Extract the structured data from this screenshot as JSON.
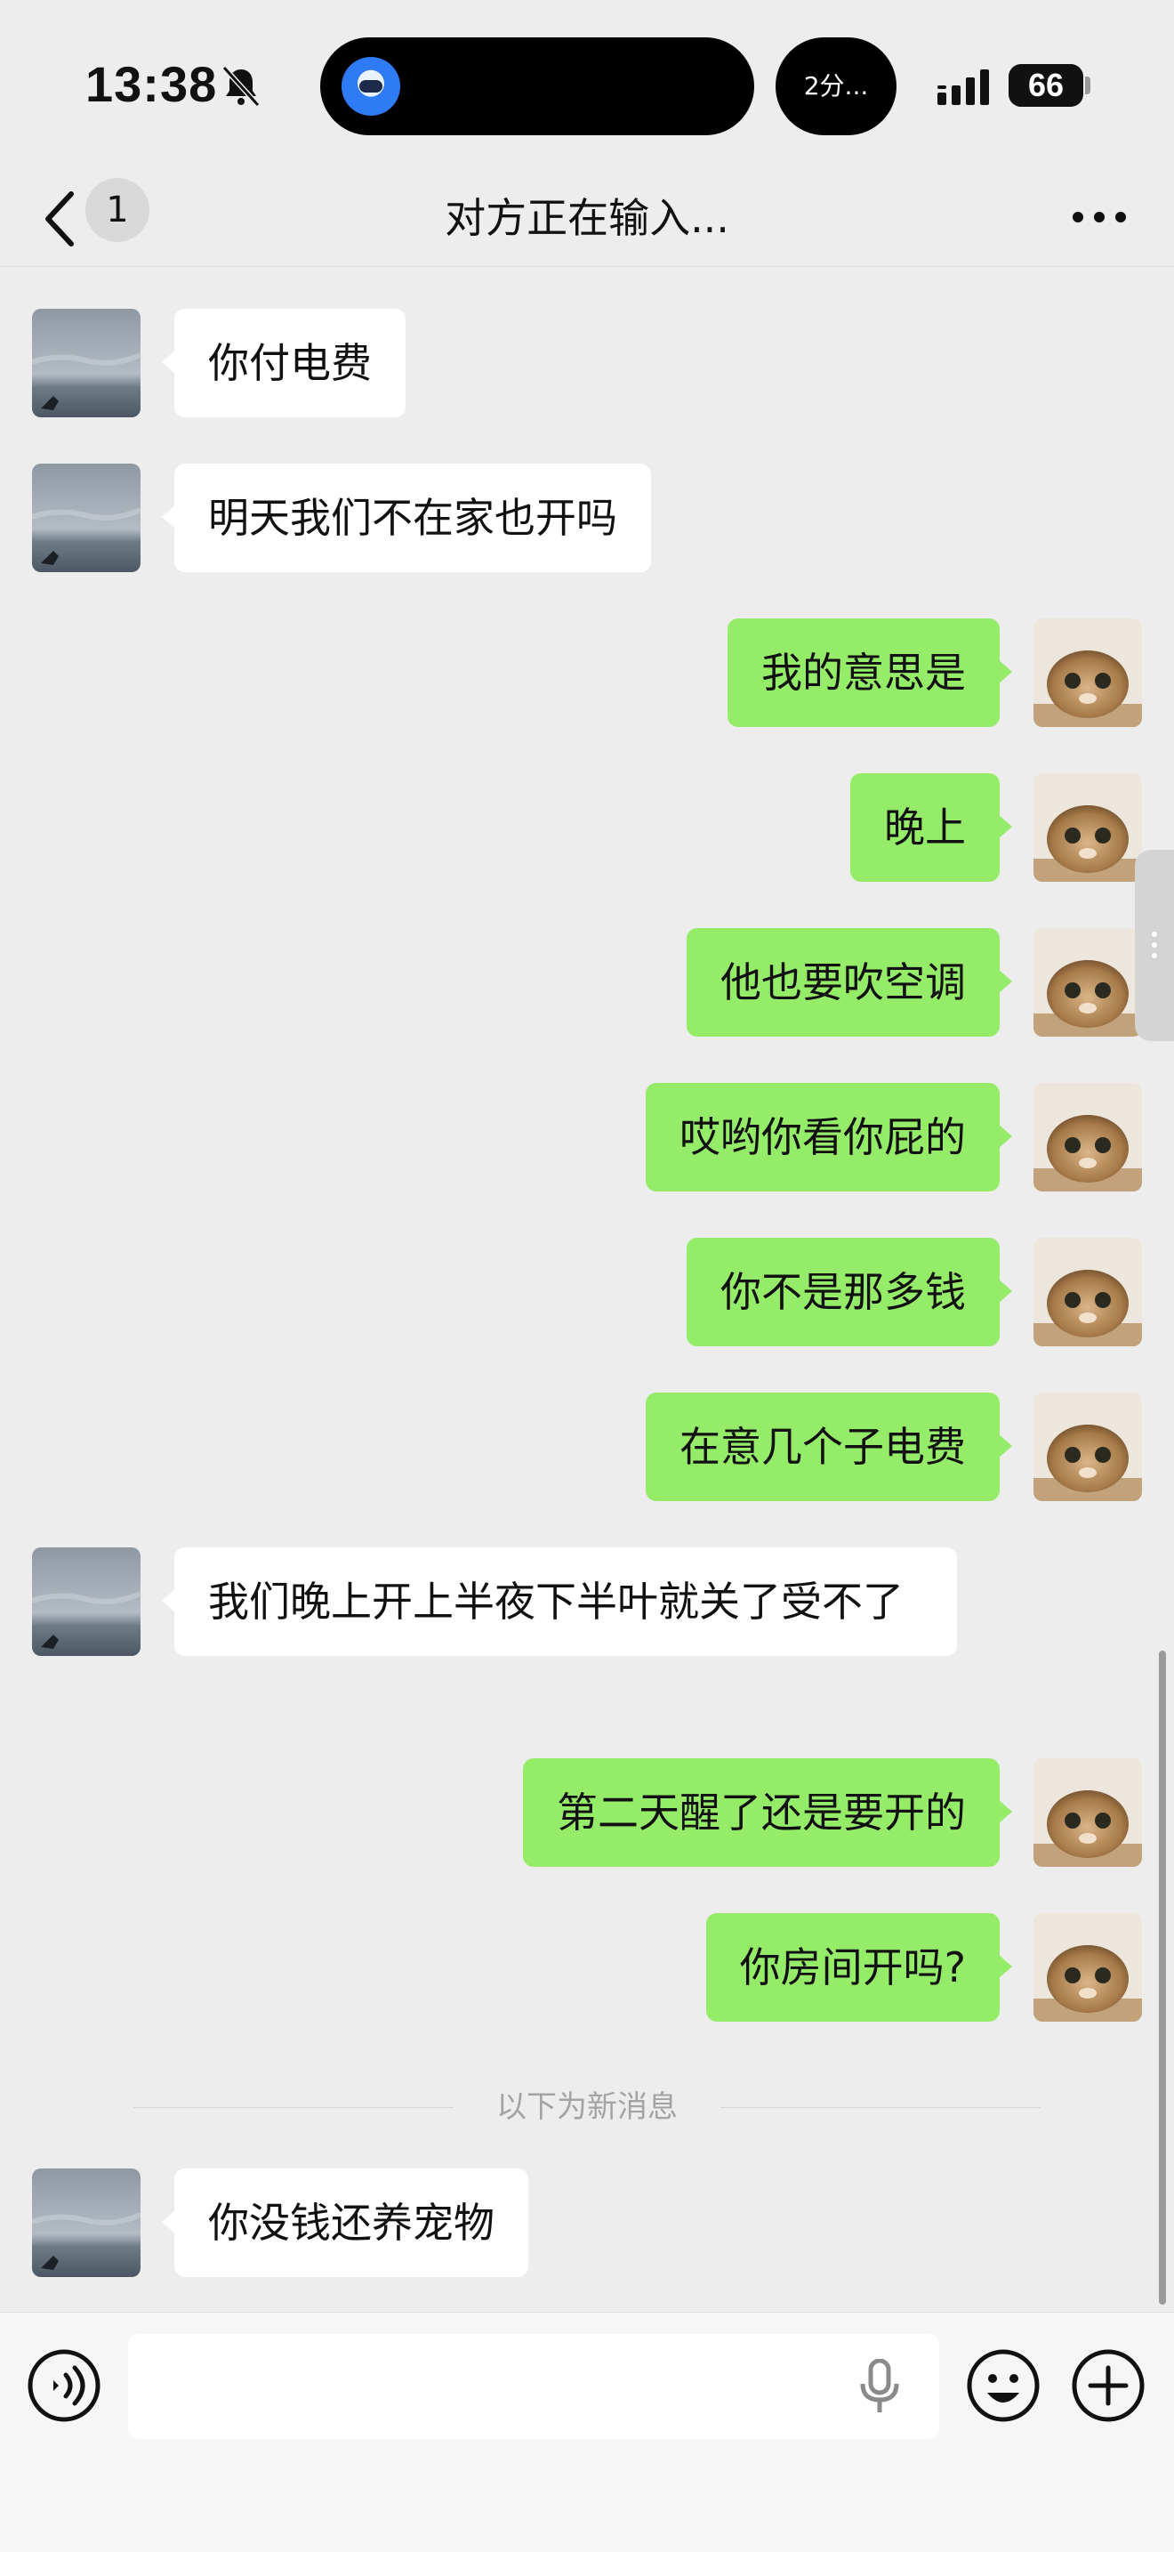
{
  "status_bar": {
    "time": "13:38",
    "timer_label": "2分...",
    "battery": "66",
    "icons": [
      "bell-off-icon",
      "signal-icon",
      "battery-icon"
    ]
  },
  "nav": {
    "back_icon": "chevron-left-icon",
    "unread_count": "1",
    "title": "对方正在输入...",
    "more_icon": "ellipsis-icon"
  },
  "colors": {
    "background": "#ededed",
    "incoming_bubble": "#ffffff",
    "outgoing_bubble": "#95ec69"
  },
  "messages": [
    {
      "from": "contact",
      "text": "你付电费"
    },
    {
      "from": "me",
      "text": "明天我们不在家也开吗"
    },
    {
      "from": "me",
      "text": "我的意思是"
    },
    {
      "from": "me",
      "text": "晚上"
    },
    {
      "from": "me",
      "text": "他也要吹空调"
    },
    {
      "from": "me",
      "text": "哎哟你看你屁的"
    },
    {
      "from": "me",
      "text": "你不是那多钱"
    },
    {
      "from": "me",
      "text": "在意几个子电费"
    },
    {
      "from": "contact",
      "text": "我们晚上开上半夜下半叶就关了受不了"
    },
    {
      "from": "me",
      "text": "第二天醒了还是要开的"
    },
    {
      "from": "me",
      "text": "你房间开吗?"
    },
    {
      "from": "contact",
      "text": "你没钱还养宠物"
    }
  ],
  "new_messages_divider": "以下为新消息",
  "input_bar": {
    "placeholder": "",
    "icons": [
      "voice-icon",
      "mic-icon",
      "emoji-icon",
      "plus-icon"
    ]
  }
}
